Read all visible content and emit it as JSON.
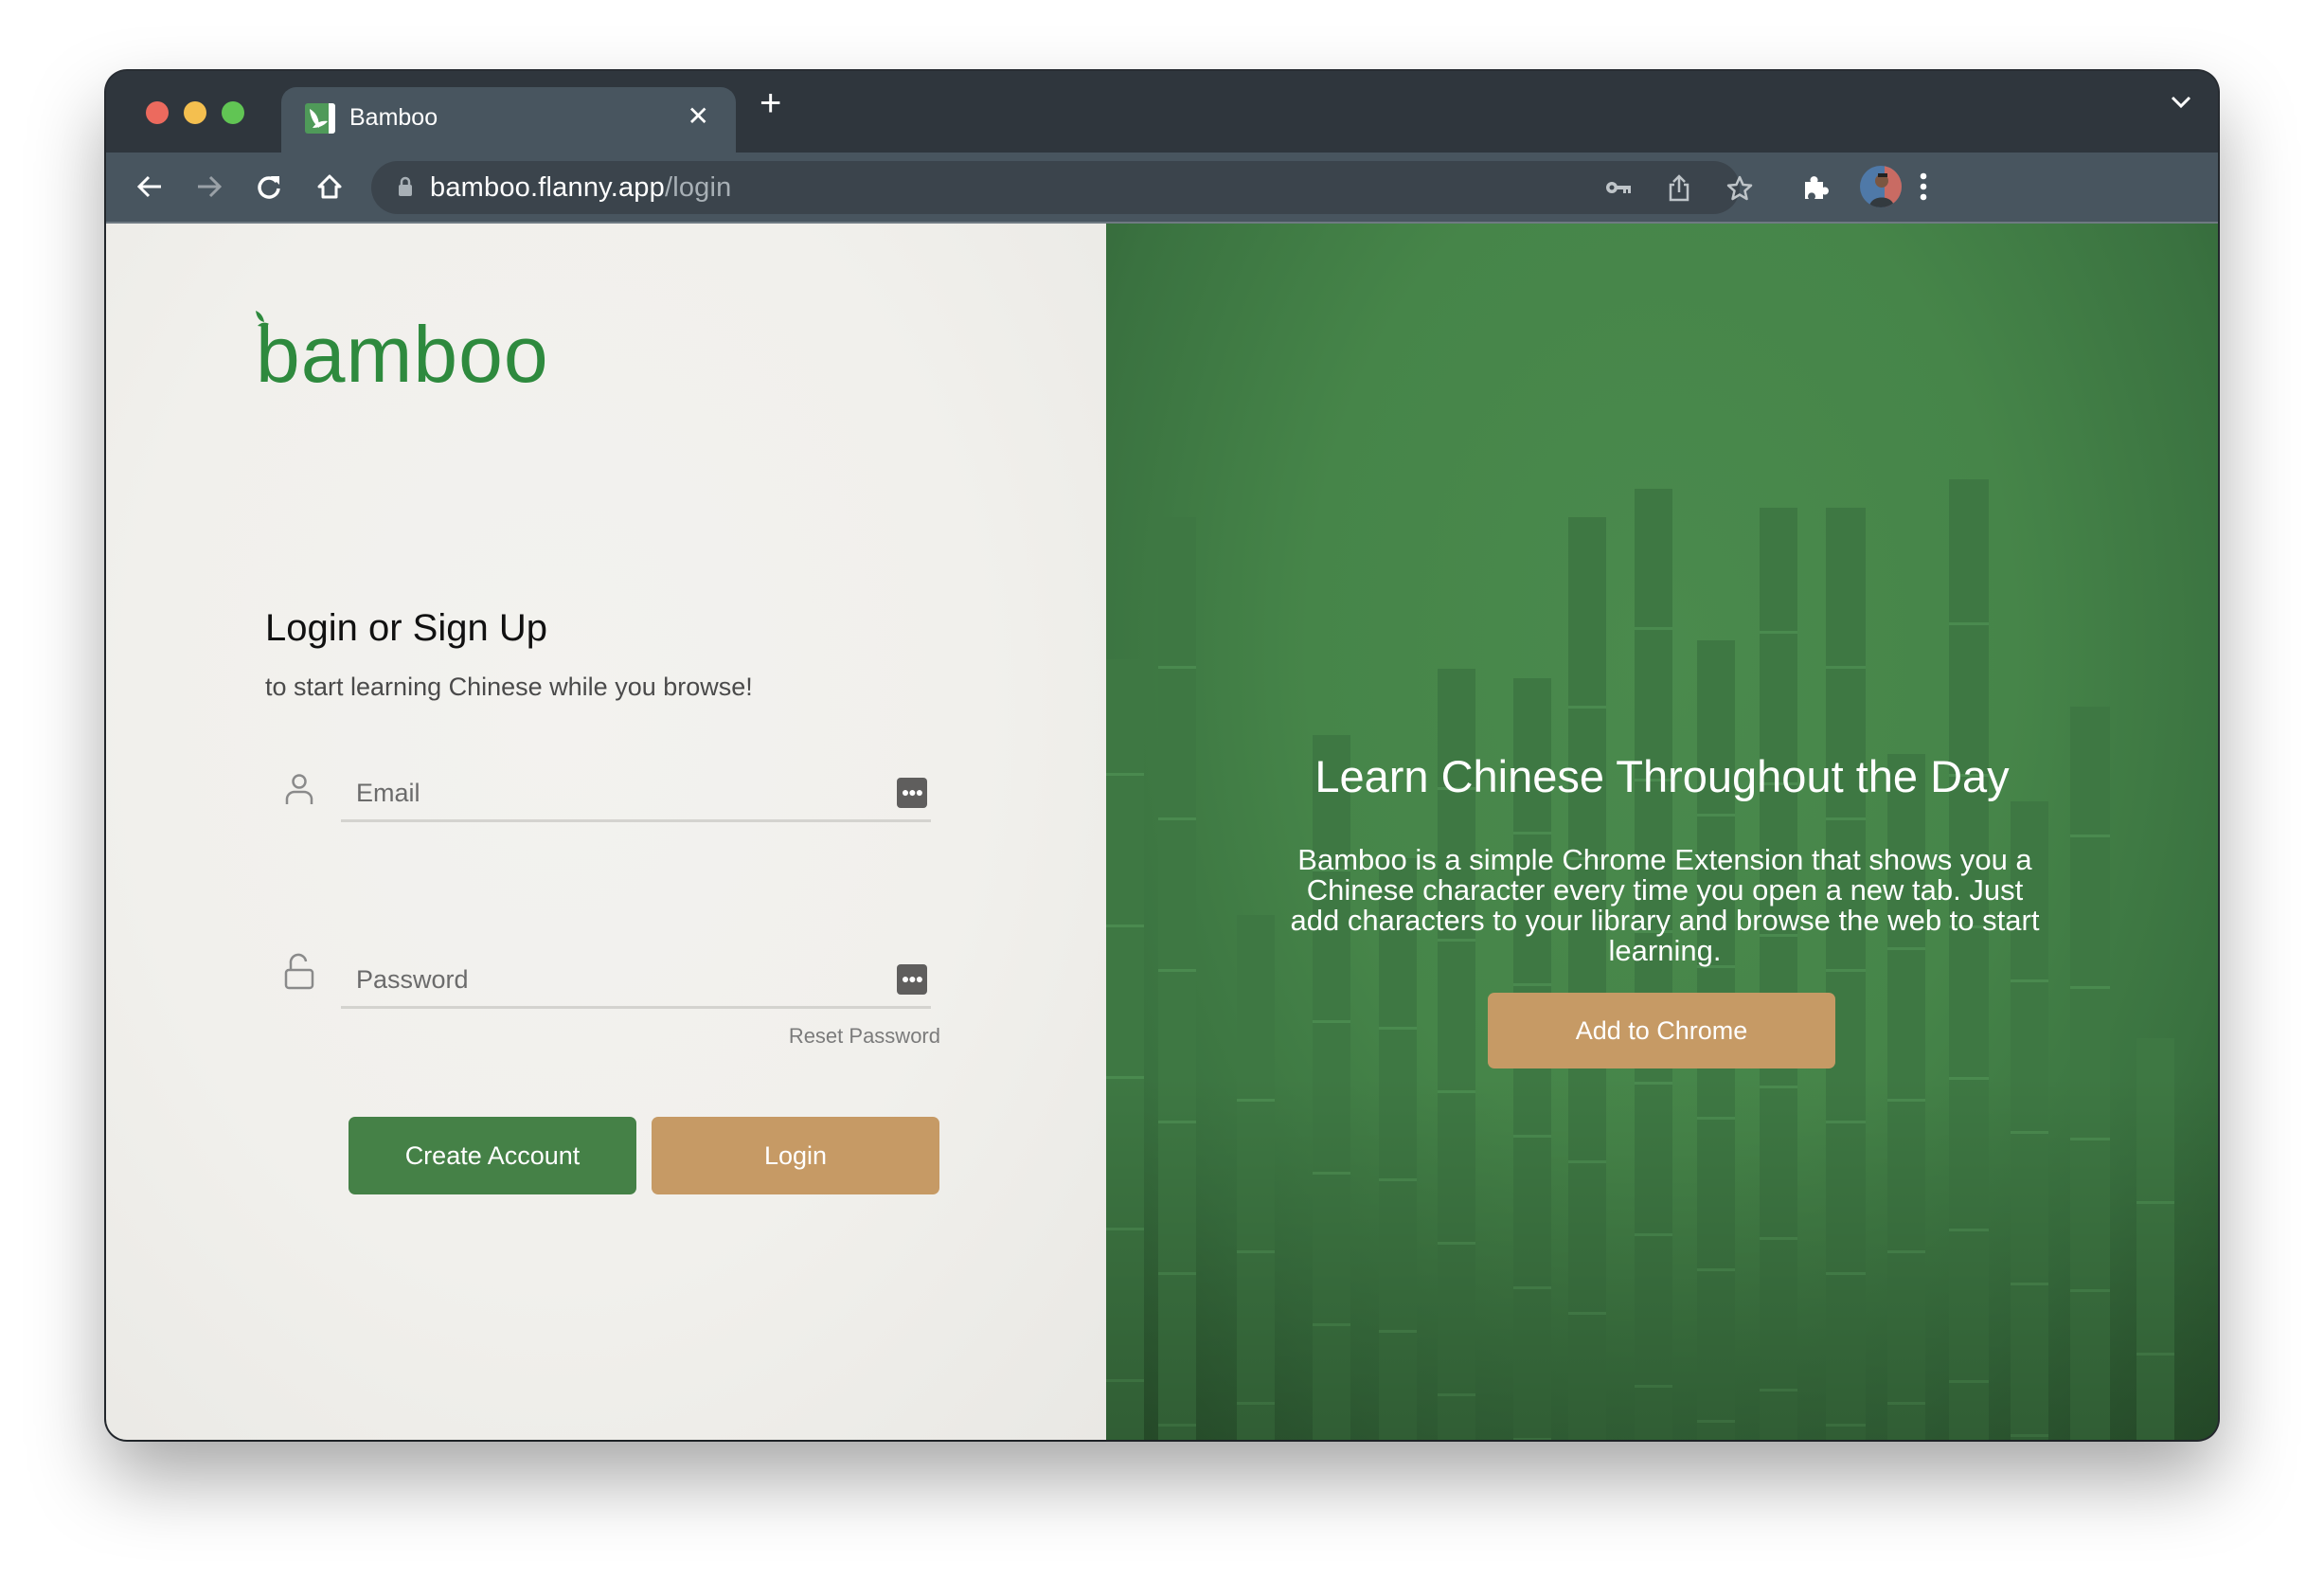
{
  "browser": {
    "tab_title": "Bamboo",
    "tab_close_icon": "close-icon",
    "new_tab_icon": "plus-icon",
    "tab_menu_icon": "chevron-down-icon",
    "url_host": "bamboo.flanny.app",
    "url_path": "/login",
    "toolbar_icons": [
      "back-arrow-icon",
      "forward-arrow-icon",
      "reload-icon",
      "home-icon",
      "lock-icon",
      "key-icon",
      "share-icon",
      "star-icon",
      "extensions-puzzle-icon",
      "profile-avatar",
      "kebab-menu-icon"
    ]
  },
  "login_panel": {
    "logo_text": "bamboo",
    "heading": "Login or Sign Up",
    "subtitle": "to start learning Chinese while you browse!",
    "email": {
      "placeholder": "Email",
      "value": "",
      "icon": "user-icon"
    },
    "password": {
      "placeholder": "Password",
      "value": "",
      "icon": "unlock-icon"
    },
    "reset_password_label": "Reset Password",
    "create_account_label": "Create Account",
    "login_label": "Login"
  },
  "promo_panel": {
    "heading": "Learn Chinese Throughout the Day",
    "description": "Bamboo is a simple Chrome Extension that shows you a Chinese character every time you open a new tab. Just add characters to your library and browse the web to start learning.",
    "add_to_chrome_label": "Add to Chrome"
  },
  "colors": {
    "brand_green": "#2e8a3e",
    "button_green": "#458147",
    "button_tan": "#c69a65",
    "panel_green": "#468549",
    "chrome_dark": "#2f363d",
    "chrome_toolbar": "#48555f"
  }
}
